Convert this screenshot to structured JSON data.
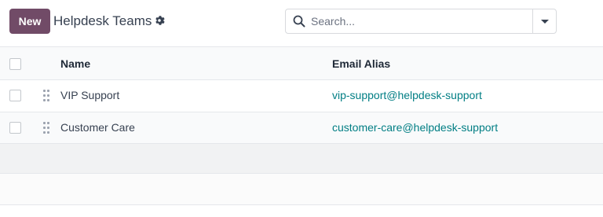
{
  "control_panel": {
    "new_label": "New",
    "title": "Helpdesk Teams",
    "search_placeholder": "Search..."
  },
  "table": {
    "columns": [
      "Name",
      "Email Alias"
    ],
    "rows": [
      {
        "name": "VIP Support",
        "email_alias": "vip-support@helpdesk-support"
      },
      {
        "name": "Customer Care",
        "email_alias": "customer-care@helpdesk-support"
      }
    ]
  },
  "colors": {
    "primary": "#714b67",
    "link": "#017e84"
  },
  "icons": [
    "gear-icon",
    "search-icon",
    "caret-down-icon",
    "drag-handle-icon"
  ]
}
